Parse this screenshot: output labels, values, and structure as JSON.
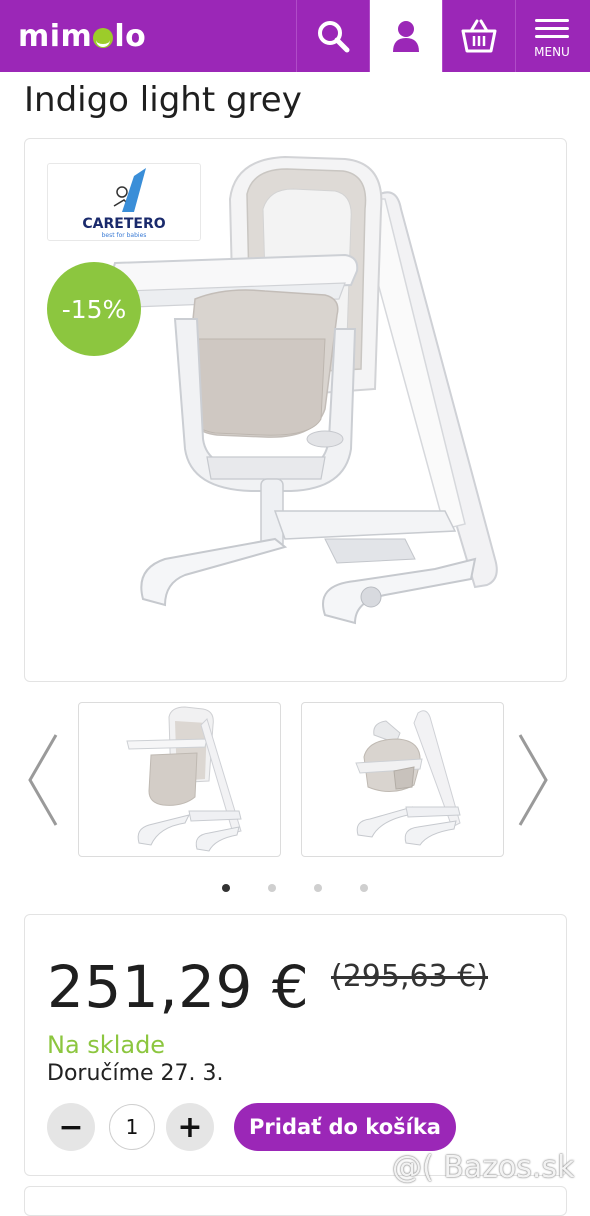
{
  "header": {
    "logo_text_left": "mim",
    "logo_text_right": "lo",
    "search_icon": "search-icon",
    "account_icon": "user-icon",
    "cart_icon": "basket-icon",
    "menu_label": "MENU",
    "colors": {
      "brand": "#9b27b7",
      "accent": "#8cc63f"
    }
  },
  "product": {
    "title": "Indigo light grey",
    "brand_badge": {
      "name": "CARETERO",
      "tagline": "best for babies"
    },
    "discount_badge": "-15%",
    "thumbnails": [
      "highchair-front",
      "swing-mode"
    ],
    "gallery_dots": {
      "count": 4,
      "active": 1
    }
  },
  "purchase": {
    "price": "251,29 €",
    "old_price": "(295,63 €)",
    "stock_status": "Na sklade",
    "delivery": "Doručíme 27. 3.",
    "quantity": "1",
    "minus_label": "−",
    "plus_label": "+",
    "add_to_cart_label": "Pridať do košíka"
  },
  "watermark": "@( Bazos.sk"
}
